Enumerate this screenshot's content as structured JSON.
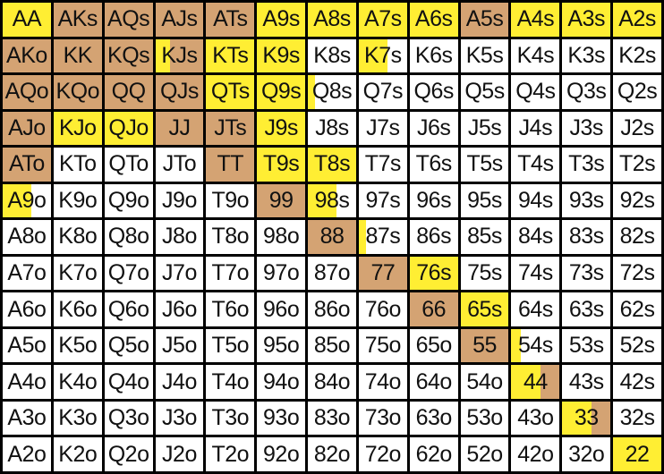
{
  "colors": {
    "raise": "#d4a373",
    "call": "#ffee33",
    "fold": "#ffffff",
    "border": "#000000"
  },
  "grid": [
    [
      {
        "t": "AA",
        "f": [
          [
            "call",
            1
          ]
        ]
      },
      {
        "t": "AKs",
        "f": [
          [
            "raise",
            1
          ]
        ]
      },
      {
        "t": "AQs",
        "f": [
          [
            "raise",
            1
          ]
        ]
      },
      {
        "t": "AJs",
        "f": [
          [
            "raise",
            1
          ]
        ]
      },
      {
        "t": "ATs",
        "f": [
          [
            "raise",
            1
          ]
        ]
      },
      {
        "t": "A9s",
        "f": [
          [
            "call",
            1
          ]
        ]
      },
      {
        "t": "A8s",
        "f": [
          [
            "call",
            1
          ]
        ]
      },
      {
        "t": "A7s",
        "f": [
          [
            "call",
            1
          ]
        ]
      },
      {
        "t": "A6s",
        "f": [
          [
            "call",
            1
          ]
        ]
      },
      {
        "t": "A5s",
        "f": [
          [
            "raise",
            1
          ]
        ]
      },
      {
        "t": "A4s",
        "f": [
          [
            "call",
            1
          ]
        ]
      },
      {
        "t": "A3s",
        "f": [
          [
            "call",
            1
          ]
        ]
      },
      {
        "t": "A2s",
        "f": [
          [
            "call",
            1
          ]
        ]
      }
    ],
    [
      {
        "t": "AKo",
        "f": [
          [
            "raise",
            1
          ]
        ]
      },
      {
        "t": "KK",
        "f": [
          [
            "raise",
            1
          ]
        ]
      },
      {
        "t": "KQs",
        "f": [
          [
            "raise",
            1
          ]
        ]
      },
      {
        "t": "KJs",
        "f": [
          [
            "call",
            0.3
          ],
          [
            "raise",
            0.7
          ]
        ]
      },
      {
        "t": "KTs",
        "f": [
          [
            "call",
            1
          ]
        ]
      },
      {
        "t": "K9s",
        "f": [
          [
            "call",
            1
          ]
        ]
      },
      {
        "t": "K8s",
        "f": []
      },
      {
        "t": "K7s",
        "f": [
          [
            "call",
            0.6
          ]
        ]
      },
      {
        "t": "K6s",
        "f": []
      },
      {
        "t": "K5s",
        "f": []
      },
      {
        "t": "K4s",
        "f": []
      },
      {
        "t": "K3s",
        "f": []
      },
      {
        "t": "K2s",
        "f": []
      }
    ],
    [
      {
        "t": "AQo",
        "f": [
          [
            "raise",
            1
          ]
        ]
      },
      {
        "t": "KQo",
        "f": [
          [
            "raise",
            1
          ]
        ]
      },
      {
        "t": "QQ",
        "f": [
          [
            "raise",
            1
          ]
        ]
      },
      {
        "t": "QJs",
        "f": [
          [
            "raise",
            1
          ]
        ]
      },
      {
        "t": "QTs",
        "f": [
          [
            "call",
            1
          ]
        ]
      },
      {
        "t": "Q9s",
        "f": [
          [
            "call",
            1
          ]
        ]
      },
      {
        "t": "Q8s",
        "f": [
          [
            "call",
            0.15
          ]
        ]
      },
      {
        "t": "Q7s",
        "f": []
      },
      {
        "t": "Q6s",
        "f": []
      },
      {
        "t": "Q5s",
        "f": []
      },
      {
        "t": "Q4s",
        "f": []
      },
      {
        "t": "Q3s",
        "f": []
      },
      {
        "t": "Q2s",
        "f": []
      }
    ],
    [
      {
        "t": "AJo",
        "f": [
          [
            "raise",
            1
          ]
        ]
      },
      {
        "t": "KJo",
        "f": [
          [
            "call",
            1
          ]
        ]
      },
      {
        "t": "QJo",
        "f": [
          [
            "call",
            1
          ]
        ]
      },
      {
        "t": "JJ",
        "f": [
          [
            "raise",
            1
          ]
        ]
      },
      {
        "t": "JTs",
        "f": [
          [
            "raise",
            1
          ]
        ]
      },
      {
        "t": "J9s",
        "f": [
          [
            "call",
            1
          ]
        ]
      },
      {
        "t": "J8s",
        "f": []
      },
      {
        "t": "J7s",
        "f": []
      },
      {
        "t": "J6s",
        "f": []
      },
      {
        "t": "J5s",
        "f": []
      },
      {
        "t": "J4s",
        "f": []
      },
      {
        "t": "J3s",
        "f": []
      },
      {
        "t": "J2s",
        "f": []
      }
    ],
    [
      {
        "t": "ATo",
        "f": [
          [
            "raise",
            1
          ]
        ]
      },
      {
        "t": "KTo",
        "f": []
      },
      {
        "t": "QTo",
        "f": []
      },
      {
        "t": "JTo",
        "f": []
      },
      {
        "t": "TT",
        "f": [
          [
            "raise",
            1
          ]
        ]
      },
      {
        "t": "T9s",
        "f": [
          [
            "call",
            1
          ]
        ]
      },
      {
        "t": "T8s",
        "f": [
          [
            "call",
            1
          ]
        ]
      },
      {
        "t": "T7s",
        "f": []
      },
      {
        "t": "T6s",
        "f": []
      },
      {
        "t": "T5s",
        "f": []
      },
      {
        "t": "T4s",
        "f": []
      },
      {
        "t": "T3s",
        "f": []
      },
      {
        "t": "T2s",
        "f": []
      }
    ],
    [
      {
        "t": "A9o",
        "f": [
          [
            "call",
            0.6
          ]
        ]
      },
      {
        "t": "K9o",
        "f": []
      },
      {
        "t": "Q9o",
        "f": []
      },
      {
        "t": "J9o",
        "f": []
      },
      {
        "t": "T9o",
        "f": []
      },
      {
        "t": "99",
        "f": [
          [
            "raise",
            1
          ]
        ]
      },
      {
        "t": "98s",
        "f": [
          [
            "call",
            0.6
          ]
        ]
      },
      {
        "t": "97s",
        "f": []
      },
      {
        "t": "96s",
        "f": []
      },
      {
        "t": "95s",
        "f": []
      },
      {
        "t": "94s",
        "f": []
      },
      {
        "t": "93s",
        "f": []
      },
      {
        "t": "92s",
        "f": []
      }
    ],
    [
      {
        "t": "A8o",
        "f": []
      },
      {
        "t": "K8o",
        "f": []
      },
      {
        "t": "Q8o",
        "f": []
      },
      {
        "t": "J8o",
        "f": []
      },
      {
        "t": "T8o",
        "f": []
      },
      {
        "t": "98o",
        "f": []
      },
      {
        "t": "88",
        "f": [
          [
            "raise",
            1
          ]
        ]
      },
      {
        "t": "87s",
        "f": [
          [
            "call",
            0.15
          ]
        ]
      },
      {
        "t": "86s",
        "f": []
      },
      {
        "t": "85s",
        "f": []
      },
      {
        "t": "84s",
        "f": []
      },
      {
        "t": "83s",
        "f": []
      },
      {
        "t": "82s",
        "f": []
      }
    ],
    [
      {
        "t": "A7o",
        "f": []
      },
      {
        "t": "K7o",
        "f": []
      },
      {
        "t": "Q7o",
        "f": []
      },
      {
        "t": "J7o",
        "f": []
      },
      {
        "t": "T7o",
        "f": []
      },
      {
        "t": "97o",
        "f": []
      },
      {
        "t": "87o",
        "f": []
      },
      {
        "t": "77",
        "f": [
          [
            "raise",
            1
          ]
        ]
      },
      {
        "t": "76s",
        "f": [
          [
            "call",
            1
          ]
        ]
      },
      {
        "t": "75s",
        "f": []
      },
      {
        "t": "74s",
        "f": []
      },
      {
        "t": "73s",
        "f": []
      },
      {
        "t": "72s",
        "f": []
      }
    ],
    [
      {
        "t": "A6o",
        "f": []
      },
      {
        "t": "K6o",
        "f": []
      },
      {
        "t": "Q6o",
        "f": []
      },
      {
        "t": "J6o",
        "f": []
      },
      {
        "t": "T6o",
        "f": []
      },
      {
        "t": "96o",
        "f": []
      },
      {
        "t": "86o",
        "f": []
      },
      {
        "t": "76o",
        "f": []
      },
      {
        "t": "66",
        "f": [
          [
            "raise",
            1
          ]
        ]
      },
      {
        "t": "65s",
        "f": [
          [
            "call",
            1
          ]
        ]
      },
      {
        "t": "64s",
        "f": []
      },
      {
        "t": "63s",
        "f": []
      },
      {
        "t": "62s",
        "f": []
      }
    ],
    [
      {
        "t": "A5o",
        "f": []
      },
      {
        "t": "K5o",
        "f": []
      },
      {
        "t": "Q5o",
        "f": []
      },
      {
        "t": "J5o",
        "f": []
      },
      {
        "t": "T5o",
        "f": []
      },
      {
        "t": "95o",
        "f": []
      },
      {
        "t": "85o",
        "f": []
      },
      {
        "t": "75o",
        "f": []
      },
      {
        "t": "65o",
        "f": []
      },
      {
        "t": "55",
        "f": [
          [
            "raise",
            1
          ]
        ]
      },
      {
        "t": "54s",
        "f": [
          [
            "call",
            0.2
          ]
        ]
      },
      {
        "t": "53s",
        "f": []
      },
      {
        "t": "52s",
        "f": []
      }
    ],
    [
      {
        "t": "A4o",
        "f": []
      },
      {
        "t": "K4o",
        "f": []
      },
      {
        "t": "Q4o",
        "f": []
      },
      {
        "t": "J4o",
        "f": []
      },
      {
        "t": "T4o",
        "f": []
      },
      {
        "t": "94o",
        "f": []
      },
      {
        "t": "84o",
        "f": []
      },
      {
        "t": "74o",
        "f": []
      },
      {
        "t": "64o",
        "f": []
      },
      {
        "t": "54o",
        "f": []
      },
      {
        "t": "44",
        "f": [
          [
            "call",
            0.6
          ],
          [
            "raise",
            0.4
          ]
        ]
      },
      {
        "t": "43s",
        "f": []
      },
      {
        "t": "42s",
        "f": []
      }
    ],
    [
      {
        "t": "A3o",
        "f": []
      },
      {
        "t": "K3o",
        "f": []
      },
      {
        "t": "Q3o",
        "f": []
      },
      {
        "t": "J3o",
        "f": []
      },
      {
        "t": "T3o",
        "f": []
      },
      {
        "t": "93o",
        "f": []
      },
      {
        "t": "83o",
        "f": []
      },
      {
        "t": "73o",
        "f": []
      },
      {
        "t": "63o",
        "f": []
      },
      {
        "t": "53o",
        "f": []
      },
      {
        "t": "43o",
        "f": []
      },
      {
        "t": "33",
        "f": [
          [
            "call",
            0.6
          ],
          [
            "raise",
            0.4
          ]
        ]
      },
      {
        "t": "32s",
        "f": []
      }
    ],
    [
      {
        "t": "A2o",
        "f": []
      },
      {
        "t": "K2o",
        "f": []
      },
      {
        "t": "Q2o",
        "f": []
      },
      {
        "t": "J2o",
        "f": []
      },
      {
        "t": "T2o",
        "f": []
      },
      {
        "t": "92o",
        "f": []
      },
      {
        "t": "82o",
        "f": []
      },
      {
        "t": "72o",
        "f": []
      },
      {
        "t": "62o",
        "f": []
      },
      {
        "t": "52o",
        "f": []
      },
      {
        "t": "42o",
        "f": []
      },
      {
        "t": "32o",
        "f": []
      },
      {
        "t": "22",
        "f": [
          [
            "call",
            1
          ]
        ]
      }
    ]
  ]
}
